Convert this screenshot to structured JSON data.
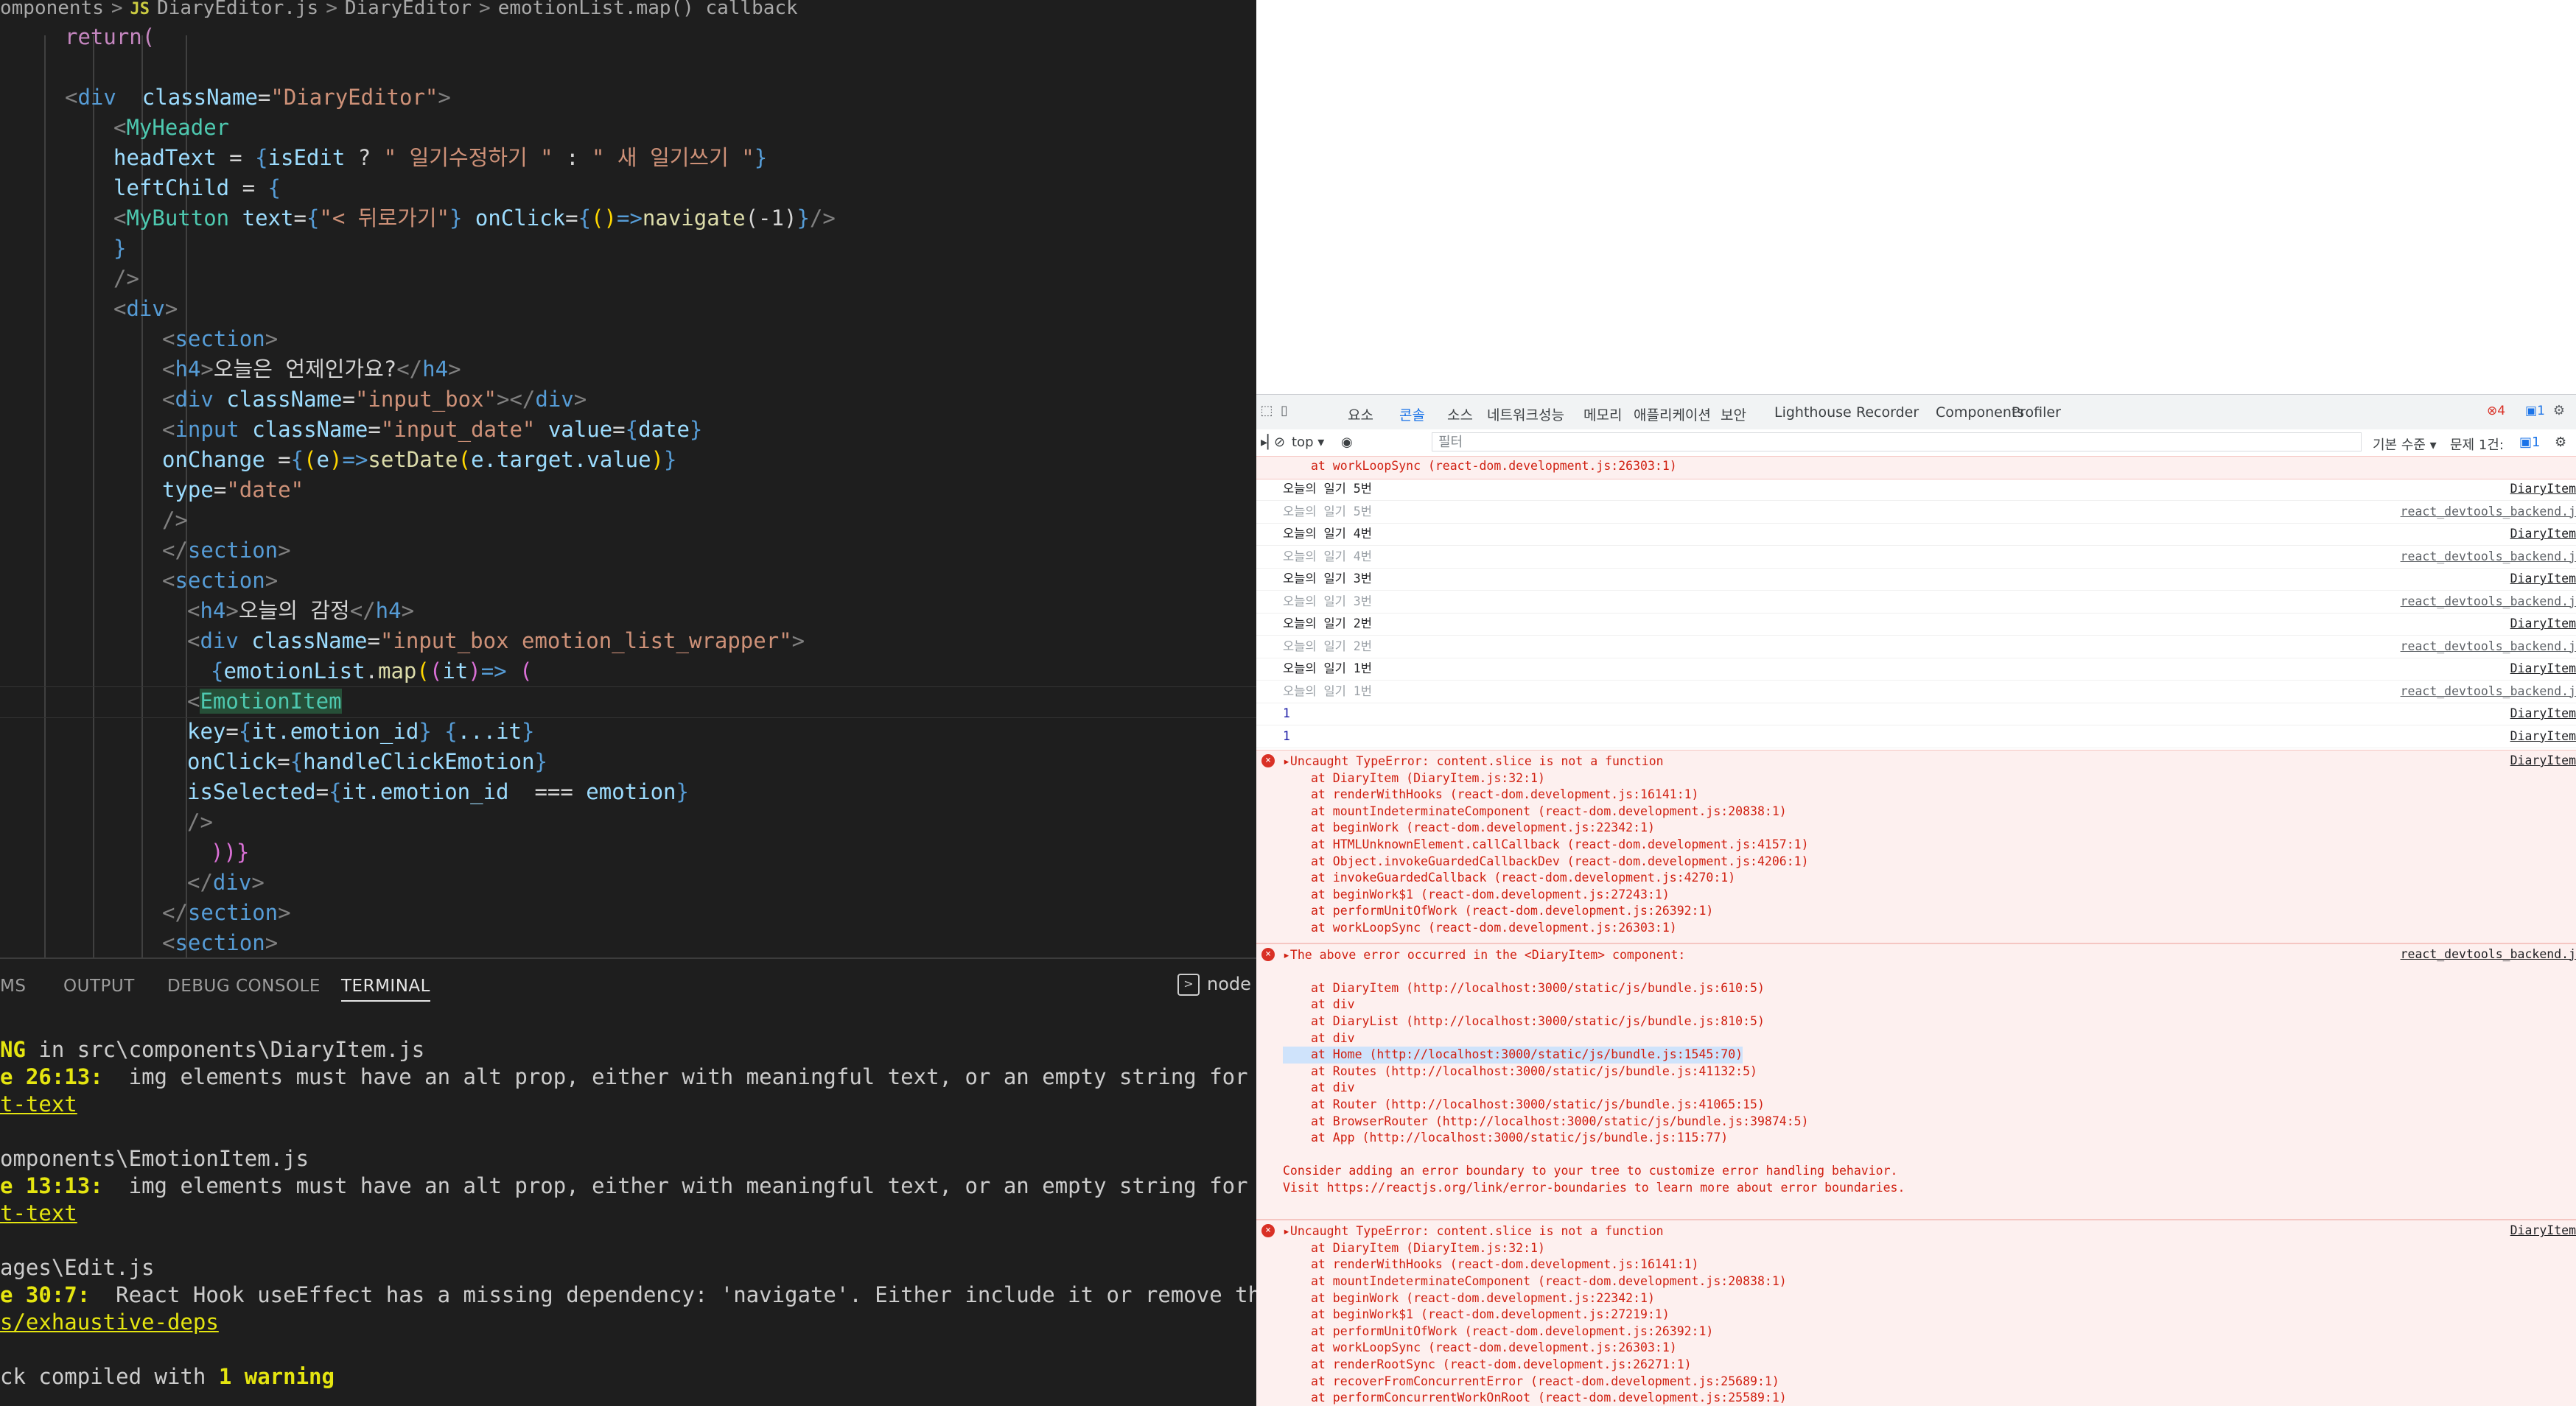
{
  "editor": {
    "breadcrumb": [
      "omponents",
      ">",
      "JS",
      "DiaryEditor.js",
      ">",
      "DiaryEditor",
      ">",
      "emotionList.map() callback"
    ],
    "code_lines": [
      {
        "indent": 88,
        "tokens": [
          [
            "return(",
            "t-kw"
          ]
        ]
      },
      {
        "indent": 88,
        "tokens": []
      },
      {
        "indent": 88,
        "tokens": [
          [
            "<",
            "t-bracket"
          ],
          [
            "div",
            "t-br"
          ],
          [
            "  className",
            "t-attr"
          ],
          [
            "=",
            "t-plain"
          ],
          [
            "\"DiaryEditor\"",
            "t-str"
          ],
          [
            ">",
            "t-bracket"
          ]
        ]
      },
      {
        "indent": 154,
        "tokens": [
          [
            "<",
            "t-bracket"
          ],
          [
            "MyHeader",
            "t-tag"
          ]
        ]
      },
      {
        "indent": 154,
        "tokens": [
          [
            "headText",
            "t-attr"
          ],
          [
            " = ",
            "t-plain"
          ],
          [
            "{",
            "t-br"
          ],
          [
            "isEdit",
            "t-attr"
          ],
          [
            " ? ",
            "t-plain"
          ],
          [
            "\" 일기수정하기 \"",
            "t-str"
          ],
          [
            " : ",
            "t-plain"
          ],
          [
            "\" 새 일기쓰기 \"",
            "t-str"
          ],
          [
            "}",
            "t-br"
          ]
        ]
      },
      {
        "indent": 154,
        "tokens": [
          [
            "leftChild",
            "t-attr"
          ],
          [
            " = ",
            "t-plain"
          ],
          [
            "{",
            "t-br"
          ]
        ]
      },
      {
        "indent": 154,
        "tokens": [
          [
            "<",
            "t-bracket"
          ],
          [
            "MyButton",
            "t-tag"
          ],
          [
            " text",
            "t-attr"
          ],
          [
            "=",
            "t-plain"
          ],
          [
            "{",
            "t-br"
          ],
          [
            "\"< 뒤로가기\"",
            "t-str"
          ],
          [
            "}",
            "t-br"
          ],
          [
            " onClick",
            "t-attr"
          ],
          [
            "=",
            "t-plain"
          ],
          [
            "{",
            "t-br"
          ],
          [
            "()",
            "t-yel"
          ],
          [
            "=>",
            "t-br"
          ],
          [
            "navigate",
            "t-fn"
          ],
          [
            "(-1)",
            "t-plain"
          ],
          [
            "}",
            "t-br"
          ],
          [
            "/>",
            "t-bracket"
          ]
        ]
      },
      {
        "indent": 154,
        "tokens": [
          [
            "}",
            "t-br"
          ]
        ]
      },
      {
        "indent": 154,
        "tokens": [
          [
            "/>",
            "t-bracket"
          ]
        ]
      },
      {
        "indent": 154,
        "tokens": [
          [
            "<",
            "t-bracket"
          ],
          [
            "div",
            "t-br"
          ],
          [
            ">",
            "t-bracket"
          ]
        ]
      },
      {
        "indent": 220,
        "tokens": [
          [
            "<",
            "t-bracket"
          ],
          [
            "section",
            "t-br"
          ],
          [
            ">",
            "t-bracket"
          ]
        ]
      },
      {
        "indent": 220,
        "tokens": [
          [
            "<",
            "t-bracket"
          ],
          [
            "h4",
            "t-br"
          ],
          [
            ">",
            "t-bracket"
          ],
          [
            "오늘은 언제인가요?",
            "t-plain"
          ],
          [
            "</",
            "t-bracket"
          ],
          [
            "h4",
            "t-br"
          ],
          [
            ">",
            "t-bracket"
          ]
        ]
      },
      {
        "indent": 220,
        "tokens": [
          [
            "<",
            "t-bracket"
          ],
          [
            "div",
            "t-br"
          ],
          [
            " className",
            "t-attr"
          ],
          [
            "=",
            "t-plain"
          ],
          [
            "\"input_box\"",
            "t-str"
          ],
          [
            "></",
            "t-bracket"
          ],
          [
            "div",
            "t-br"
          ],
          [
            ">",
            "t-bracket"
          ]
        ]
      },
      {
        "indent": 220,
        "tokens": [
          [
            "<",
            "t-bracket"
          ],
          [
            "input",
            "t-br"
          ],
          [
            " className",
            "t-attr"
          ],
          [
            "=",
            "t-plain"
          ],
          [
            "\"input_date\"",
            "t-str"
          ],
          [
            " value",
            "t-attr"
          ],
          [
            "=",
            "t-plain"
          ],
          [
            "{",
            "t-br"
          ],
          [
            "date",
            "t-attr"
          ],
          [
            "}",
            "t-br"
          ]
        ]
      },
      {
        "indent": 220,
        "tokens": [
          [
            "onChange",
            "t-attr"
          ],
          [
            " =",
            "t-plain"
          ],
          [
            "{",
            "t-br"
          ],
          [
            "(",
            "t-yel"
          ],
          [
            "e",
            "t-attr"
          ],
          [
            ")",
            "t-yel"
          ],
          [
            "=>",
            "t-br"
          ],
          [
            "setDate",
            "t-fn"
          ],
          [
            "(",
            "t-yel"
          ],
          [
            "e.target.value",
            "t-attr"
          ],
          [
            ")",
            "t-yel"
          ],
          [
            "}",
            "t-br"
          ]
        ]
      },
      {
        "indent": 220,
        "tokens": [
          [
            "type",
            "t-attr"
          ],
          [
            "=",
            "t-plain"
          ],
          [
            "\"date\"",
            "t-str"
          ]
        ]
      },
      {
        "indent": 220,
        "tokens": [
          [
            "/>",
            "t-bracket"
          ]
        ]
      },
      {
        "indent": 220,
        "tokens": [
          [
            "</",
            "t-bracket"
          ],
          [
            "section",
            "t-br"
          ],
          [
            ">",
            "t-bracket"
          ]
        ]
      },
      {
        "indent": 220,
        "tokens": [
          [
            "<",
            "t-bracket"
          ],
          [
            "section",
            "t-br"
          ],
          [
            ">",
            "t-bracket"
          ]
        ]
      },
      {
        "indent": 254,
        "tokens": [
          [
            "<",
            "t-bracket"
          ],
          [
            "h4",
            "t-br"
          ],
          [
            ">",
            "t-bracket"
          ],
          [
            "오늘의 감정",
            "t-plain"
          ],
          [
            "</",
            "t-bracket"
          ],
          [
            "h4",
            "t-br"
          ],
          [
            ">",
            "t-bracket"
          ]
        ]
      },
      {
        "indent": 254,
        "tokens": [
          [
            "<",
            "t-bracket"
          ],
          [
            "div",
            "t-br"
          ],
          [
            " className",
            "t-attr"
          ],
          [
            "=",
            "t-plain"
          ],
          [
            "\"input_box emotion_list_wrapper\"",
            "t-str"
          ],
          [
            ">",
            "t-bracket"
          ]
        ]
      },
      {
        "indent": 286,
        "tokens": [
          [
            "{",
            "t-br"
          ],
          [
            "emotionList",
            "t-attr"
          ],
          [
            ".",
            "t-plain"
          ],
          [
            "map",
            "t-fn"
          ],
          [
            "(",
            "t-yel"
          ],
          [
            "(",
            "t-pink"
          ],
          [
            "it",
            "t-attr"
          ],
          [
            ")",
            "t-pink"
          ],
          [
            "=>",
            "t-br"
          ],
          [
            " (",
            "t-pink"
          ]
        ]
      },
      {
        "indent": 254,
        "tokens": [
          [
            "<",
            "t-bracket"
          ],
          [
            "EmotionItem",
            "t-hl"
          ]
        ]
      },
      {
        "indent": 254,
        "tokens": [
          [
            "key",
            "t-attr"
          ],
          [
            "=",
            "t-plain"
          ],
          [
            "{",
            "t-br"
          ],
          [
            "it.emotion_id",
            "t-attr"
          ],
          [
            "}",
            "t-br"
          ],
          [
            " {",
            "t-br"
          ],
          [
            "...it",
            "t-attr"
          ],
          [
            "}",
            "t-br"
          ]
        ]
      },
      {
        "indent": 254,
        "tokens": [
          [
            "onClick",
            "t-attr"
          ],
          [
            "=",
            "t-plain"
          ],
          [
            "{",
            "t-br"
          ],
          [
            "handleClickEmotion",
            "t-attr"
          ],
          [
            "}",
            "t-br"
          ]
        ]
      },
      {
        "indent": 254,
        "tokens": [
          [
            "isSelected",
            "t-attr"
          ],
          [
            "=",
            "t-plain"
          ],
          [
            "{",
            "t-br"
          ],
          [
            "it.emotion_id",
            "t-attr"
          ],
          [
            "  === ",
            "t-plain"
          ],
          [
            "emotion",
            "t-attr"
          ],
          [
            "}",
            "t-br"
          ]
        ]
      },
      {
        "indent": 254,
        "tokens": [
          [
            "/>",
            "t-bracket"
          ]
        ]
      },
      {
        "indent": 286,
        "tokens": [
          [
            "))}",
            "t-pink"
          ]
        ]
      },
      {
        "indent": 254,
        "tokens": [
          [
            "</",
            "t-bracket"
          ],
          [
            "div",
            "t-br"
          ],
          [
            ">",
            "t-bracket"
          ]
        ]
      },
      {
        "indent": 220,
        "tokens": [
          [
            "</",
            "t-bracket"
          ],
          [
            "section",
            "t-br"
          ],
          [
            ">",
            "t-bracket"
          ]
        ]
      },
      {
        "indent": 220,
        "tokens": [
          [
            "<",
            "t-bracket"
          ],
          [
            "section",
            "t-br"
          ],
          [
            ">",
            "t-bracket"
          ]
        ]
      }
    ]
  },
  "panel": {
    "tabs": [
      "MS",
      "OUTPUT",
      "DEBUG CONSOLE",
      "TERMINAL"
    ],
    "active_tab": "TERMINAL",
    "node_label": "node",
    "terminal_lines": [
      [
        [
          "NG",
          "tw"
        ],
        [
          " in src\\components\\DiaryItem.js",
          ""
        ]
      ],
      [
        [
          "e 26:13:",
          "tw"
        ],
        [
          "  img elements must have an alt prop, either with meaningful text, or an empty string for decorativ",
          ""
        ]
      ],
      [
        [
          "t-text",
          "tu"
        ]
      ],
      [
        [
          "",
          ""
        ]
      ],
      [
        [
          "omponents\\EmotionItem.js",
          ""
        ]
      ],
      [
        [
          "e 13:13:",
          "tw"
        ],
        [
          "  img elements must have an alt prop, either with meaningful text, or an empty string for decorativ",
          ""
        ]
      ],
      [
        [
          "t-text",
          "tu"
        ]
      ],
      [
        [
          "",
          ""
        ]
      ],
      [
        [
          "ages\\Edit.js",
          ""
        ]
      ],
      [
        [
          "e 30:7:",
          "tw"
        ],
        [
          "  React Hook useEffect has a missing dependency: 'navigate'. Either include it or remove the depende",
          ""
        ]
      ],
      [
        [
          "s/exhaustive-deps",
          "tu"
        ]
      ],
      [
        [
          "",
          ""
        ]
      ],
      [
        [
          "ck compiled with ",
          ""
        ],
        [
          "1 warning",
          "tw"
        ]
      ]
    ]
  },
  "devtools": {
    "tabs": [
      "요소",
      "콘솔",
      "소스",
      "네트워크",
      "성능",
      "메모리",
      "애플리케이션",
      "보안",
      "Lighthouse",
      "Recorder",
      "Components",
      "Profiler"
    ],
    "active_tab": "콘솔",
    "error_count": "4",
    "message_count": "1",
    "toolbar": {
      "context": "top ▾",
      "filter_placeholder": "필터",
      "level": "기본 수준 ▾",
      "issues_label": "문제 1건:",
      "issues_count": "1"
    },
    "top_partial_line": "at workLoopSync (react-dom.development.js:26303:1)",
    "log_rows": [
      {
        "msg": "오늘의 일기 5번",
        "src": "DiaryItem",
        "faded": false
      },
      {
        "msg": "오늘의 일기 5번",
        "src": "react_devtools_backend.j",
        "faded": true
      },
      {
        "msg": "오늘의 일기 4번",
        "src": "DiaryItem",
        "faded": false
      },
      {
        "msg": "오늘의 일기 4번",
        "src": "react_devtools_backend.j",
        "faded": true
      },
      {
        "msg": "오늘의 일기 3번",
        "src": "DiaryItem",
        "faded": false
      },
      {
        "msg": "오늘의 일기 3번",
        "src": "react_devtools_backend.j",
        "faded": true
      },
      {
        "msg": "오늘의 일기 2번",
        "src": "DiaryItem",
        "faded": false
      },
      {
        "msg": "오늘의 일기 2번",
        "src": "react_devtools_backend.j",
        "faded": true
      },
      {
        "msg": "오늘의 일기 1번",
        "src": "DiaryItem",
        "faded": false
      },
      {
        "msg": "오늘의 일기 1번",
        "src": "react_devtools_backend.j",
        "faded": true
      },
      {
        "msg": "1",
        "src": "DiaryItem",
        "faded": false,
        "num": true
      },
      {
        "msg": "1",
        "src": "DiaryItem",
        "faded": false,
        "num": true
      }
    ],
    "errors": [
      {
        "title": "▸Uncaught TypeError: content.slice is not a function",
        "src": "DiaryItem",
        "stack": [
          "at DiaryItem (DiaryItem.js:32:1)",
          "at renderWithHooks (react-dom.development.js:16141:1)",
          "at mountIndeterminateComponent (react-dom.development.js:20838:1)",
          "at beginWork (react-dom.development.js:22342:1)",
          "at HTMLUnknownElement.callCallback (react-dom.development.js:4157:1)",
          "at Object.invokeGuardedCallbackDev (react-dom.development.js:4206:1)",
          "at invokeGuardedCallback (react-dom.development.js:4270:1)",
          "at beginWork$1 (react-dom.development.js:27243:1)",
          "at performUnitOfWork (react-dom.development.js:26392:1)",
          "at workLoopSync (react-dom.development.js:26303:1)"
        ]
      },
      {
        "title": "▸The above error occurred in the <DiaryItem> component:",
        "src": "react_devtools_backend.j",
        "stack": [
          "",
          "at DiaryItem (http://localhost:3000/static/js/bundle.js:610:5)",
          "at div",
          "at DiaryList (http://localhost:3000/static/js/bundle.js:810:5)",
          "at div",
          "at Home (http://localhost:3000/static/js/bundle.js:1545:70)",
          "at Routes (http://localhost:3000/static/js/bundle.js:41132:5)",
          "at div",
          "at Router (http://localhost:3000/static/js/bundle.js:41065:15)",
          "at BrowserRouter (http://localhost:3000/static/js/bundle.js:39874:5)",
          "at App (http://localhost:3000/static/js/bundle.js:115:77)",
          ""
        ],
        "footer": [
          "Consider adding an error boundary to your tree to customize error handling behavior.",
          "Visit https://reactjs.org/link/error-boundaries to learn more about error boundaries."
        ]
      },
      {
        "title": "▸Uncaught TypeError: content.slice is not a function",
        "src": "DiaryItem",
        "stack": [
          "at DiaryItem (DiaryItem.js:32:1)",
          "at renderWithHooks (react-dom.development.js:16141:1)",
          "at mountIndeterminateComponent (react-dom.development.js:20838:1)",
          "at beginWork (react-dom.development.js:22342:1)",
          "at beginWork$1 (react-dom.development.js:27219:1)",
          "at performUnitOfWork (react-dom.development.js:26392:1)",
          "at workLoopSync (react-dom.development.js:26303:1)",
          "at renderRootSync (react-dom.development.js:26271:1)",
          "at recoverFromConcurrentError (react-dom.development.js:25689:1)",
          "at performConcurrentWorkOnRoot (react-dom.development.js:25589:1)"
        ]
      }
    ],
    "prompt": "›"
  }
}
